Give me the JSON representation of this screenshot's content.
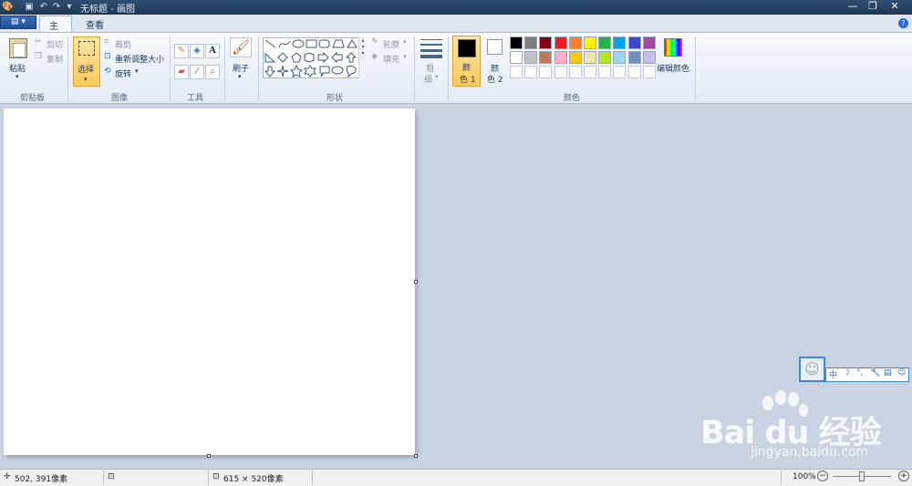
{
  "window": {
    "title": "无标题 - 画图"
  },
  "tabs": {
    "file": "▤ ▾",
    "home": "主页",
    "view": "查看"
  },
  "help": "?",
  "clipboard": {
    "paste": "粘贴",
    "cut": "剪切",
    "copy": "复制",
    "group": "剪贴板"
  },
  "image": {
    "select": "选择",
    "crop": "裁剪",
    "resize": "重新调整大小",
    "rotate": "旋转",
    "group": "图像"
  },
  "tools": {
    "group": "工具"
  },
  "brushes": {
    "label": "刷子"
  },
  "shapes": {
    "outline": "轮廓",
    "fill": "填充",
    "group": "形状"
  },
  "size": {
    "label_line1": "粗",
    "label_line2": "细"
  },
  "colors": {
    "color1_line1": "颜",
    "color1_line2": "色 1",
    "color2_line1": "颜",
    "color2_line2": "色 2",
    "edit": "编辑颜色",
    "group": "颜色",
    "color1_value": "#000000",
    "color2_value": "#ffffff",
    "palette_row1": [
      "#000000",
      "#7f7f7f",
      "#880015",
      "#ed1c24",
      "#ff7f27",
      "#fff200",
      "#22b14c",
      "#00a2e8",
      "#3f48cc",
      "#a349a4"
    ],
    "palette_row2": [
      "#ffffff",
      "#c3c3c3",
      "#b97a57",
      "#ffaec9",
      "#ffc90e",
      "#efe4b0",
      "#b5e61d",
      "#99d9ea",
      "#7092be",
      "#c8bfe7"
    ],
    "palette_row3": [
      "#ffffff",
      "#ffffff",
      "#ffffff",
      "#ffffff",
      "#ffffff",
      "#ffffff",
      "#ffffff",
      "#ffffff",
      "#ffffff",
      "#ffffff"
    ]
  },
  "status": {
    "cursor": "502, 391像素",
    "canvas_size": "615 × 520像素",
    "zoom": "100%"
  },
  "ime": {
    "chars": [
      "中",
      "☽",
      "°,",
      "🔧",
      "▤",
      "☺"
    ]
  },
  "watermark": {
    "logo": "Bai du 经验",
    "url": "jingyan.baidu.com"
  }
}
